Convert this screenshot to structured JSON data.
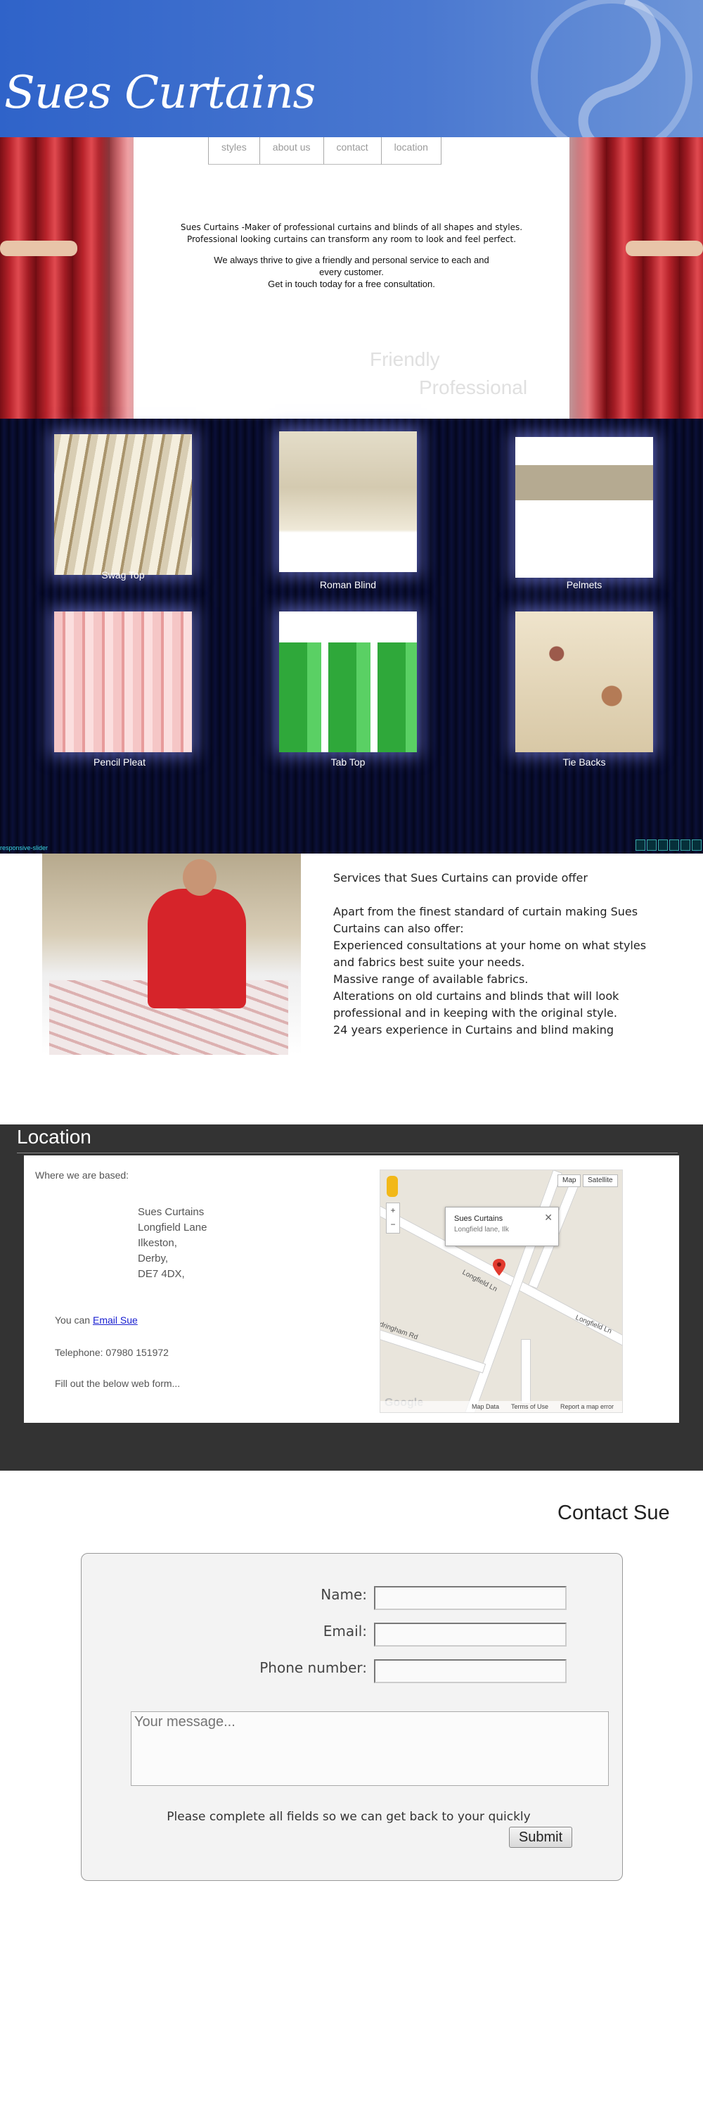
{
  "brand": {
    "logo": "Sues Curtains"
  },
  "nav": {
    "items": [
      "styles",
      "about us",
      "contact",
      "location"
    ]
  },
  "intro": {
    "line1_brand": "Sues Curtains",
    "line1_rest": " -Maker of professional curtains and blinds of all shapes and styles.",
    "line2": "Professional looking curtains can transform any room to look and feel perfect.",
    "line3": "We always thrive to give a friendly and personal service to each and",
    "line4": "every customer.",
    "line5": "Get in touch today for a free consultation.",
    "tag1": "Friendly",
    "tag2": "Professional"
  },
  "gallery": {
    "items": [
      {
        "label": "Swag Top"
      },
      {
        "label": "Roman Blind"
      },
      {
        "label": "Pelmets"
      },
      {
        "label": "Pencil Pleat"
      },
      {
        "label": "Tab Top"
      },
      {
        "label": "Tie Backs"
      }
    ],
    "slider_label": "responsive-slider"
  },
  "services": {
    "title": "Services that Sues Curtains can provide offer",
    "intro": "Apart from the finest standard of curtain making Sues Curtains can also offer:",
    "items": [
      "Experienced consultations at your home on what styles and fabrics best suite your needs.",
      "Massive range of available fabrics.",
      "Alterations on old curtains and blinds that will look professional and in keeping with the original style.",
      "24 years experience in Curtains and blind making"
    ]
  },
  "location": {
    "title": "Location",
    "based_label": "Where we are based:",
    "address": [
      "Sues Curtains",
      "Longfield Lane",
      "Ilkeston,",
      "Derby,",
      "DE7 4DX,"
    ],
    "email_prefix": "You can ",
    "email_link": "Email Sue",
    "telephone": "Telephone: 07980 151972",
    "form_hint": "Fill out the below web form...",
    "map": {
      "btn_map": "Map",
      "btn_satellite": "Satellite",
      "popup_title": "Sues Curtains",
      "popup_sub": "Longfield lane, Ilk",
      "road_label_1": "Longfield Ln",
      "road_label_2": "Longfield Ln",
      "road_label_3": "Sandringham Rd",
      "footer_data": "Map Data",
      "footer_terms": "Terms of Use",
      "footer_report": "Report a map error",
      "google": "Google"
    }
  },
  "contact": {
    "title": "Contact Sue",
    "name_label": "Name:",
    "email_label": "Email:",
    "phone_label": "Phone number:",
    "message_placeholder": "Your message...",
    "note": "Please complete all fields so we can get back to your quickly",
    "submit": "Submit"
  },
  "colors": {
    "header_blue": "#2f63c9",
    "curtain_red": "#b8232b",
    "gallery_bg": "#050820",
    "location_bg": "#333333",
    "link": "#1a20d0"
  }
}
